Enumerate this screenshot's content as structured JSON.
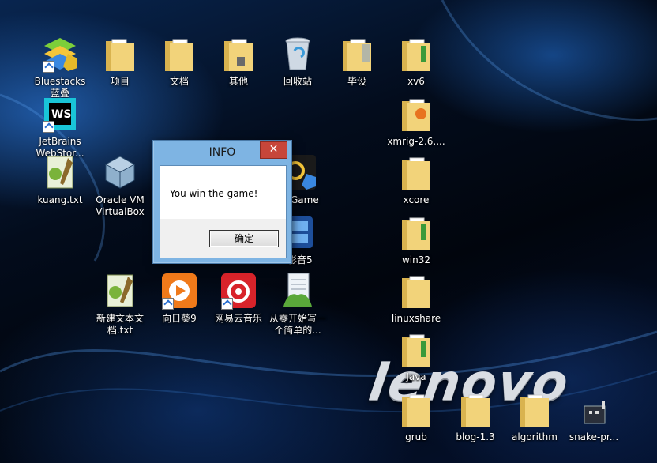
{
  "dialog": {
    "title": "INFO",
    "close_glyph": "✕",
    "message": "You win the game!",
    "ok_label": "确定"
  },
  "branding": {
    "logo_text": "lenovo"
  },
  "desktop": {
    "icons": [
      {
        "label": "Bluestacks 蓝叠",
        "icon": "bluestacks-icon"
      },
      {
        "label": "项目",
        "icon": "folder-icon"
      },
      {
        "label": "文档",
        "icon": "folder-icon"
      },
      {
        "label": "其他",
        "icon": "folder-icon"
      },
      {
        "label": "回收站",
        "icon": "recycle-bin-icon"
      },
      {
        "label": "毕设",
        "icon": "folder-icon"
      },
      {
        "label": "xv6",
        "icon": "folder-icon"
      },
      {
        "label": "JetBrains WebStor...",
        "icon": "webstorm-icon"
      },
      {
        "label": "xmrig-2.6....",
        "icon": "folder-icon"
      },
      {
        "label": "kuang.txt",
        "icon": "text-file-icon"
      },
      {
        "label": "Oracle VM VirtualBox",
        "icon": "virtualbox-icon"
      },
      {
        "label": "Game",
        "icon": "game-icon"
      },
      {
        "label": "xcore",
        "icon": "folder-icon"
      },
      {
        "label": "影音5",
        "icon": "media-player-icon"
      },
      {
        "label": "win32",
        "icon": "folder-icon"
      },
      {
        "label": "新建文本文档.txt",
        "icon": "text-file-icon"
      },
      {
        "label": "向日葵9",
        "icon": "sunflower-icon"
      },
      {
        "label": "网易云音乐",
        "icon": "netease-music-icon"
      },
      {
        "label": "从零开始写一个简单的...",
        "icon": "document-icon"
      },
      {
        "label": "linuxshare",
        "icon": "folder-icon"
      },
      {
        "label": "Java",
        "icon": "folder-icon"
      },
      {
        "label": "grub",
        "icon": "folder-icon"
      },
      {
        "label": "blog-1.3",
        "icon": "folder-icon"
      },
      {
        "label": "algorithm",
        "icon": "folder-icon"
      },
      {
        "label": "snake-pr...",
        "icon": "project-icon"
      }
    ]
  },
  "colors": {
    "dialog_frame": "#7eb4e3",
    "close_button": "#c7463a",
    "folder": "#f2d37a"
  }
}
